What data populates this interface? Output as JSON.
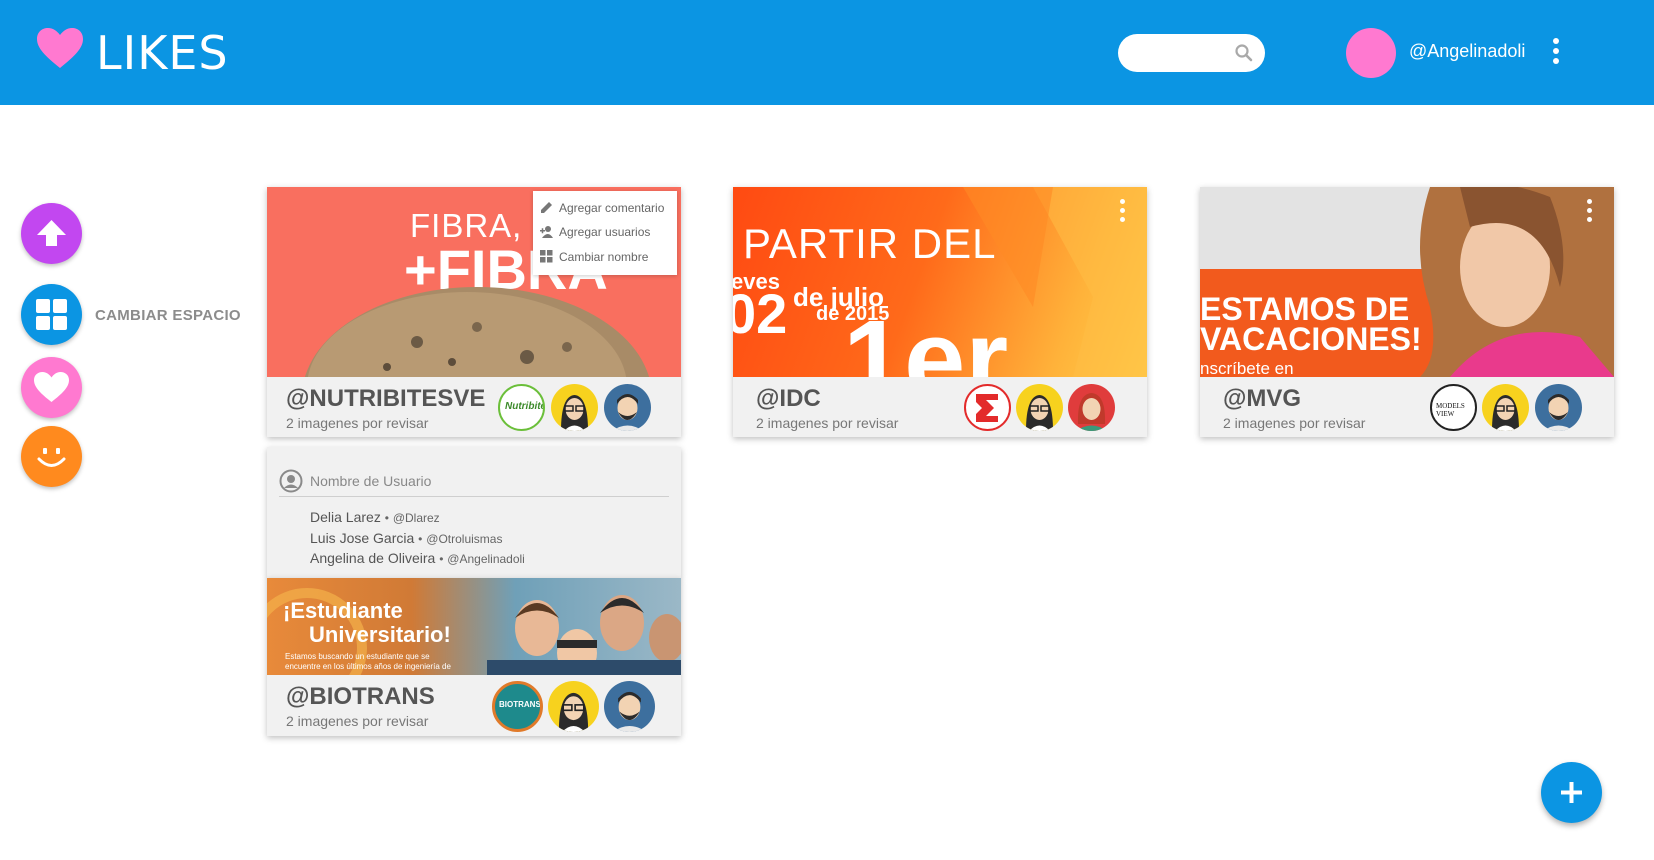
{
  "header": {
    "app_title": "LIKES",
    "search_placeholder": "",
    "username": "@Angelinadoli",
    "brand_color": "#0b95e3",
    "logo_icon": "heart-icon"
  },
  "sidebar": {
    "buttons": [
      {
        "name": "upload",
        "icon": "arrow-up-icon",
        "color": "#c247f0"
      },
      {
        "name": "spaces",
        "icon": "grid-icon",
        "color": "#0b95e3",
        "label": "CAMBIAR ESPACIO"
      },
      {
        "name": "likes",
        "icon": "heart-icon",
        "color": "#ff79d0"
      },
      {
        "name": "emoji",
        "icon": "smiley-icon",
        "color": "#ff8a1e"
      }
    ]
  },
  "cards": [
    {
      "handle": "@NUTRIBITESVE",
      "subtitle": "2 imagenes por revisar",
      "banner_lines": [
        "FIBRA, F",
        "+FIBRA"
      ],
      "banner_color": "#f96f5f",
      "avatars": [
        "nutribites-logo",
        "woman-avatar",
        "man-avatar"
      ]
    },
    {
      "handle": "@IDC",
      "subtitle": "2 imagenes por revisar",
      "banner_lines": [
        "PARTIR DEL",
        "eves",
        "02",
        "de julio",
        "de 2015",
        "1er"
      ],
      "banner_color": "#ff6a1a",
      "avatars": [
        "idc-logo",
        "woman-avatar",
        "redhead-avatar"
      ]
    },
    {
      "handle": "@MVG",
      "subtitle": "2 imagenes por revisar",
      "banner_lines": [
        "ESTAMOS DE",
        "VACACIONES!",
        "nscríbete en"
      ],
      "banner_color": "#f25a1d",
      "avatars": [
        "models-view-logo",
        "woman-avatar",
        "man-avatar"
      ]
    },
    {
      "handle": "@BIOTRANS",
      "subtitle": "2 imagenes por revisar",
      "banner_lines": [
        "¡Estudiante",
        "Universitario!",
        "Estamos buscando un estudiante que se",
        "encuentre en los últimos años de ingeniería de"
      ],
      "banner_color": "#e88a3a",
      "avatars": [
        "biotrans-logo",
        "woman-avatar",
        "man-avatar"
      ]
    }
  ],
  "context_menu": {
    "items": [
      {
        "label": "Agregar comentario",
        "icon": "pencil-icon"
      },
      {
        "label": "Agregar usuarios",
        "icon": "add-user-icon"
      },
      {
        "label": "Cambiar nombre",
        "icon": "grid-icon"
      }
    ]
  },
  "user_panel": {
    "placeholder": "Nombre de Usuario",
    "users": [
      {
        "name": "Delia Larez",
        "handle": "@Dlarez"
      },
      {
        "name": "Luis Jose Garcia",
        "handle": "@Otroluismas"
      },
      {
        "name": "Angelina de Oliveira",
        "handle": "@Angelinadoli"
      }
    ],
    "separator": "•"
  },
  "fab": {
    "icon": "plus-icon"
  }
}
